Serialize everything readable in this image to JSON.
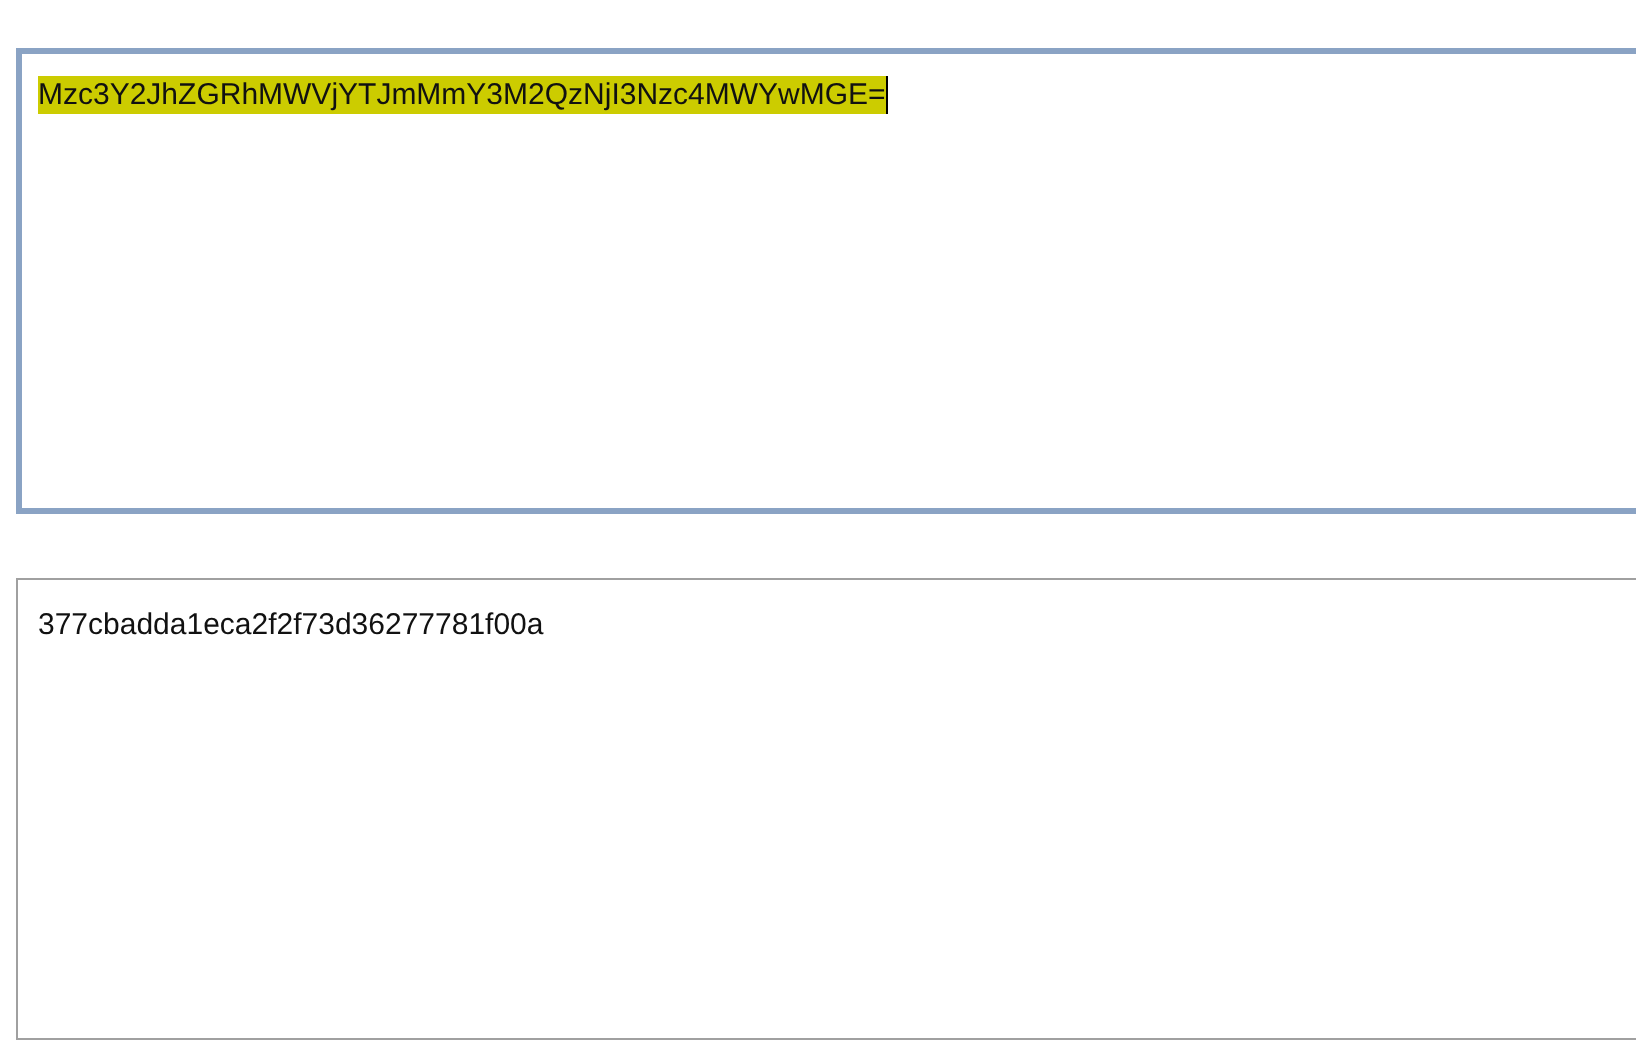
{
  "fields": [
    {
      "value": "Mzc3Y2JhZGRhMWVjYTJmMmY3M2QzNjI3Nzc4MWYwMGE=",
      "focused": true,
      "selected": true
    },
    {
      "value": "377cbadda1eca2f2f73d36277781f00a",
      "focused": false,
      "selected": false
    }
  ]
}
